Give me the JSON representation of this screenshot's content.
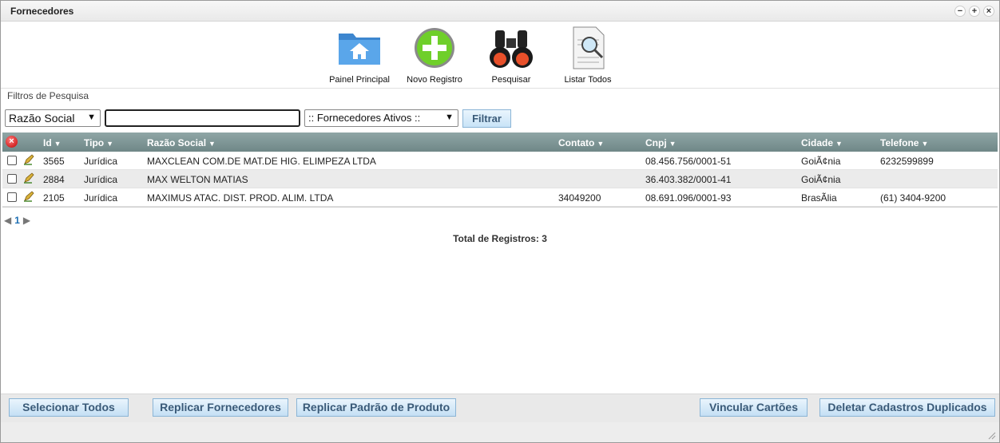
{
  "window": {
    "title": "Fornecedores",
    "controls": [
      "−",
      "+",
      "×"
    ]
  },
  "toolbar": {
    "items": [
      {
        "label": "Painel Principal",
        "icon": "home-folder-icon"
      },
      {
        "label": "Novo Registro",
        "icon": "add-circle-icon"
      },
      {
        "label": "Pesquisar",
        "icon": "binoculars-icon"
      },
      {
        "label": "Listar Todos",
        "icon": "document-search-icon"
      }
    ]
  },
  "filters": {
    "label": "Filtros de Pesquisa",
    "field_select": "Razão Social",
    "search_value": "",
    "status_select": ":: Fornecedores Ativos ::",
    "filter_button": "Filtrar"
  },
  "grid": {
    "columns": [
      "Id",
      "Tipo",
      "Razão Social",
      "Contato",
      "Cnpj",
      "Cidade",
      "Telefone"
    ],
    "rows": [
      {
        "id": "3565",
        "tipo": "Jurídica",
        "razao": "MAXCLEAN COM.DE MAT.DE HIG. ELIMPEZA LTDA",
        "contato": "",
        "cnpj": "08.456.756/0001-51",
        "cidade": "GoiÃ¢nia",
        "telefone": "6232599899"
      },
      {
        "id": "2884",
        "tipo": "Jurídica",
        "razao": "MAX WELTON MATIAS",
        "contato": "",
        "cnpj": "36.403.382/0001-41",
        "cidade": "GoiÃ¢nia",
        "telefone": ""
      },
      {
        "id": "2105",
        "tipo": "Jurídica",
        "razao": "MAXIMUS ATAC. DIST. PROD. ALIM. LTDA",
        "contato": "34049200",
        "cnpj": "08.691.096/0001-93",
        "cidade": "BrasÃlia",
        "telefone": "(61) 3404-9200"
      }
    ]
  },
  "pager": {
    "current_page": "1"
  },
  "total": "Total de Registros: 3",
  "footer": {
    "select_all": "Selecionar Todos",
    "replicate_suppliers": "Replicar Fornecedores",
    "replicate_product_pattern": "Replicar Padrão de Produto",
    "link_cards": "Vincular Cartões",
    "delete_duplicates": "Deletar Cadastros Duplicados"
  },
  "colors": {
    "header_bg": "#7d9595",
    "button_bg": "#c8e3f7",
    "button_text": "#3a5a78",
    "alt_row": "#ebebeb"
  }
}
